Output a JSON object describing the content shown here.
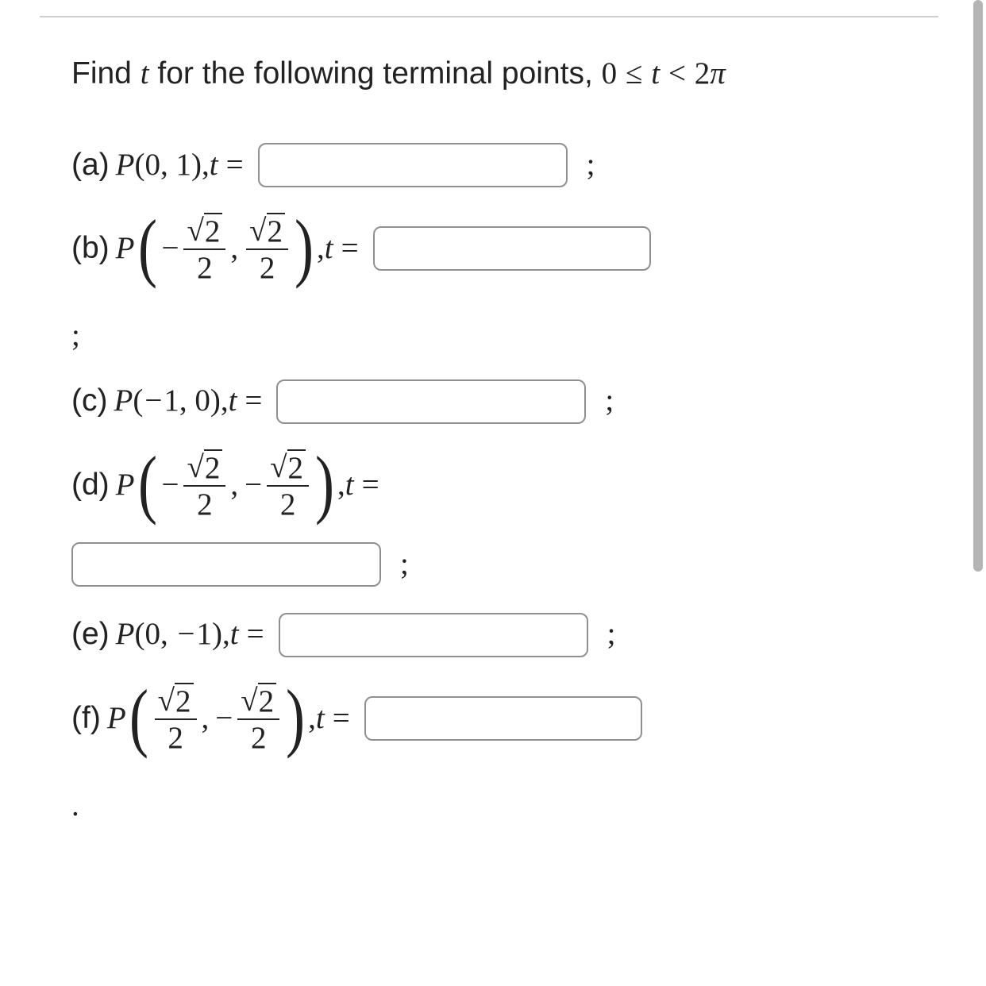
{
  "prompt": {
    "lead": "Find ",
    "var": "t",
    "mid": " for the following terminal points, ",
    "range_lhs_num": "0",
    "range_le": "≤",
    "range_mid_var": "t",
    "range_lt": "<",
    "range_rhs_coef": "2",
    "range_rhs_pi": "π"
  },
  "items": {
    "a": {
      "tag": "(a) ",
      "P": "P",
      "open": "(",
      "x": "0",
      "c": ",",
      "y": "1",
      "close": ")",
      "comma": ", ",
      "t": "t",
      "eq": "=",
      "semi": ";"
    },
    "b": {
      "tag": "(b) ",
      "P": "P",
      "neg1": "−",
      "rt2a": "2",
      "den_a": "2",
      "comma_in": ",",
      "rt2b": "2",
      "den_b": "2",
      "comma": ", ",
      "t": "t",
      "eq": "="
    },
    "b_semi": ";",
    "c": {
      "tag": "(c) ",
      "P": "P",
      "open": "(",
      "neg": "−",
      "x": "1",
      "c": ",",
      "y": "0",
      "close": ")",
      "comma": ", ",
      "t": "t",
      "eq": "=",
      "semi": ";"
    },
    "d": {
      "tag": "(d) ",
      "P": "P",
      "neg1": "−",
      "rt2a": "2",
      "den_a": "2",
      "comma_in": ",",
      "neg2": "−",
      "rt2b": "2",
      "den_b": "2",
      "comma": ", ",
      "t": "t",
      "eq": "="
    },
    "d_semi": ";",
    "e": {
      "tag": "(e) ",
      "P": "P",
      "open": "(",
      "x": "0",
      "c": ",",
      "neg": "−",
      "y": "1",
      "close": ")",
      "comma": ", ",
      "t": "t",
      "eq": "=",
      "semi": ";"
    },
    "f": {
      "tag": "(f) ",
      "P": "P",
      "rt2a": "2",
      "den_a": "2",
      "comma_in": ",",
      "neg2": "−",
      "rt2b": "2",
      "den_b": "2",
      "comma": ", ",
      "t": "t",
      "eq": "="
    },
    "f_dot": "."
  },
  "root_symbol": "√"
}
